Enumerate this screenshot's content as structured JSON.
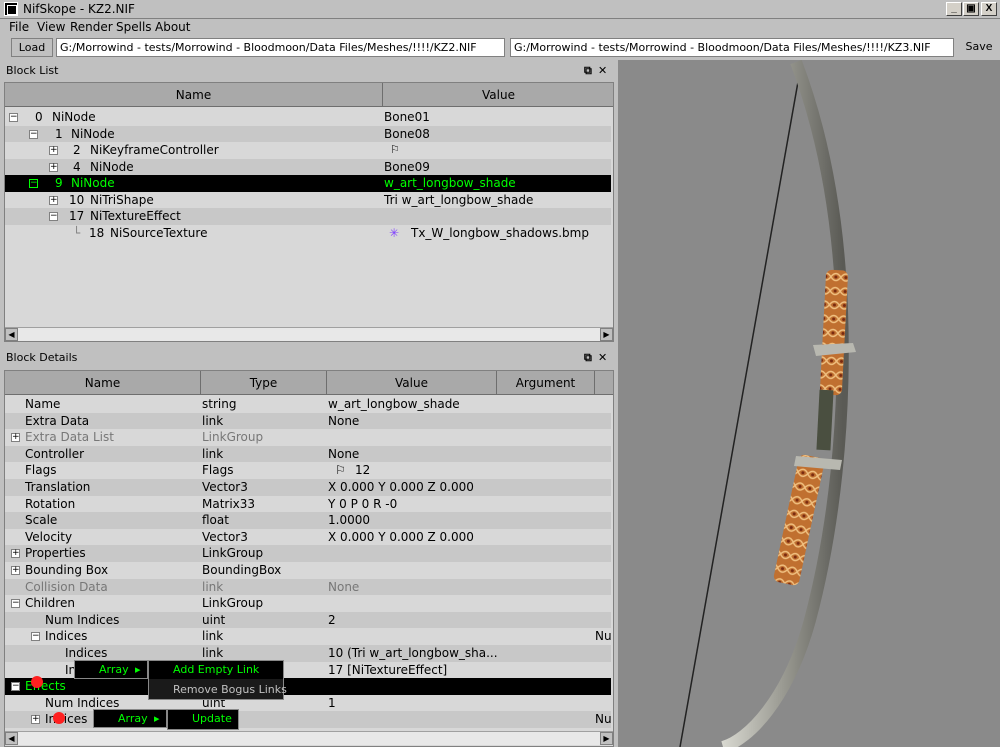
{
  "window": {
    "title": "NifSkope - KZ2.NIF",
    "minimize": "_",
    "restore": "▣",
    "close": "X"
  },
  "menu": [
    "File",
    "View",
    "Render",
    "Spells",
    "About"
  ],
  "toolbar": {
    "load_label": "Load",
    "path_left": "G:/Morrowind - tests/Morrowind - Bloodmoon/Data Files/Meshes/!!!!/KZ2.NIF",
    "path_right": "G:/Morrowind - tests/Morrowind - Bloodmoon/Data Files/Meshes/!!!!/KZ3.NIF",
    "save_label": "Save"
  },
  "block_list": {
    "title": "Block List",
    "columns": [
      "Name",
      "Value"
    ],
    "rows": [
      {
        "id": "0",
        "name": "NiNode",
        "value": "Bone01"
      },
      {
        "id": "1",
        "name": "NiNode",
        "value": "Bone08"
      },
      {
        "id": "2",
        "name": "NiKeyframeController",
        "value": ""
      },
      {
        "id": "4",
        "name": "NiNode",
        "value": "Bone09"
      },
      {
        "id": "9",
        "name": "NiNode",
        "value": "w_art_longbow_shade"
      },
      {
        "id": "10",
        "name": "NiTriShape",
        "value": "Tri w_art_longbow_shade"
      },
      {
        "id": "17",
        "name": "NiTextureEffect",
        "value": ""
      },
      {
        "id": "18",
        "name": "NiSourceTexture",
        "value": "Tx_W_longbow_shadows.bmp"
      }
    ]
  },
  "block_details": {
    "title": "Block Details",
    "columns": [
      "Name",
      "Type",
      "Value",
      "Argument"
    ],
    "rows": [
      {
        "name": "Name",
        "type": "string",
        "value": "w_art_longbow_shade",
        "arg": ""
      },
      {
        "name": "Extra Data",
        "type": "link",
        "value": "None",
        "arg": ""
      },
      {
        "name": "Extra Data List",
        "type": "LinkGroup",
        "value": "",
        "arg": ""
      },
      {
        "name": "Controller",
        "type": "link",
        "value": "None",
        "arg": ""
      },
      {
        "name": "Flags",
        "type": "Flags",
        "value": "12",
        "arg": ""
      },
      {
        "name": "Translation",
        "type": "Vector3",
        "value": "X 0.000 Y 0.000 Z 0.000",
        "arg": ""
      },
      {
        "name": "Rotation",
        "type": "Matrix33",
        "value": "Y 0 P 0 R -0",
        "arg": ""
      },
      {
        "name": "Scale",
        "type": "float",
        "value": "1.0000",
        "arg": ""
      },
      {
        "name": "Velocity",
        "type": "Vector3",
        "value": "X 0.000 Y 0.000 Z 0.000",
        "arg": ""
      },
      {
        "name": "Properties",
        "type": "LinkGroup",
        "value": "",
        "arg": ""
      },
      {
        "name": "Bounding Box",
        "type": "BoundingBox",
        "value": "",
        "arg": ""
      },
      {
        "name": "Collision Data",
        "type": "link",
        "value": "None",
        "arg": ""
      },
      {
        "name": "Children",
        "type": "LinkGroup",
        "value": "",
        "arg": ""
      },
      {
        "name": "Num Indices",
        "type": "uint",
        "value": "2",
        "arg": ""
      },
      {
        "name": "Indices",
        "type": "link",
        "value": "",
        "arg": "Nu"
      },
      {
        "name": "Indices",
        "type": "link",
        "value": "10 (Tri w_art_longbow_sha...",
        "arg": ""
      },
      {
        "name": "In",
        "type": "",
        "value": "17 [NiTextureEffect]",
        "arg": ""
      },
      {
        "name": "Effects",
        "type": "",
        "value": "",
        "arg": ""
      },
      {
        "name": "Num Indices",
        "type": "uint_",
        "value": "1",
        "arg": ""
      },
      {
        "name": "Indices",
        "type": "",
        "value": "",
        "arg": "Nu"
      }
    ]
  },
  "context_menu_1": {
    "item": "Array",
    "submenu": [
      "Add Empty Link",
      "Remove Bogus Links"
    ]
  },
  "context_menu_2": {
    "item": "Array",
    "submenu": [
      "Update"
    ]
  }
}
